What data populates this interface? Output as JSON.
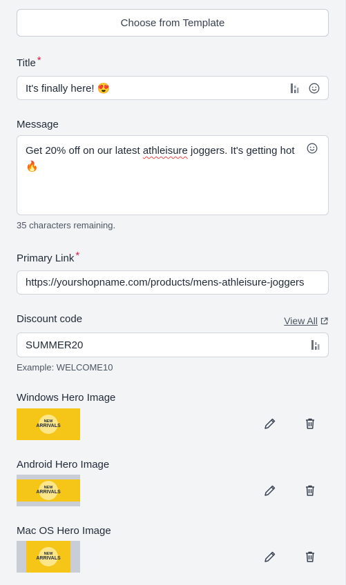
{
  "template_button": "Choose from Template",
  "title": {
    "label": "Title",
    "required_mark": "*",
    "value": "It's finally here! 😍"
  },
  "message": {
    "label": "Message",
    "text_before": "Get 20% off on our latest ",
    "misspelled": "athleisure",
    "text_after": " joggers. It's getting hot 🔥",
    "remaining": "35 characters remaining."
  },
  "primary_link": {
    "label": "Primary Link",
    "required_mark": "*",
    "value": "https://yourshopname.com/products/mens-athleisure-joggers"
  },
  "discount": {
    "label": "Discount code",
    "view_all": "View All",
    "value": "SUMMER20",
    "example": "Example: WELCOME10"
  },
  "hero_images": [
    {
      "label": "Windows Hero Image",
      "badge_line1": "NEW",
      "badge_line2": "ARRIVALS",
      "format": "wide"
    },
    {
      "label": "Android Hero Image",
      "badge_line1": "NEW",
      "badge_line2": "ARRIVALS",
      "format": "padded-vertical"
    },
    {
      "label": "Mac OS Hero Image",
      "badge_line1": "NEW",
      "badge_line2": "ARRIVALS",
      "format": "padded-horizontal"
    }
  ],
  "colors": {
    "background": "#f3f4f6",
    "required": "#e11d48",
    "image_yellow": "#f5c518",
    "image_grey": "#c9ced6"
  },
  "icons": {
    "variable": "personalize-icon",
    "emoji": "smiley-icon",
    "external": "external-link-icon",
    "edit": "pencil-icon",
    "delete": "trash-icon"
  }
}
